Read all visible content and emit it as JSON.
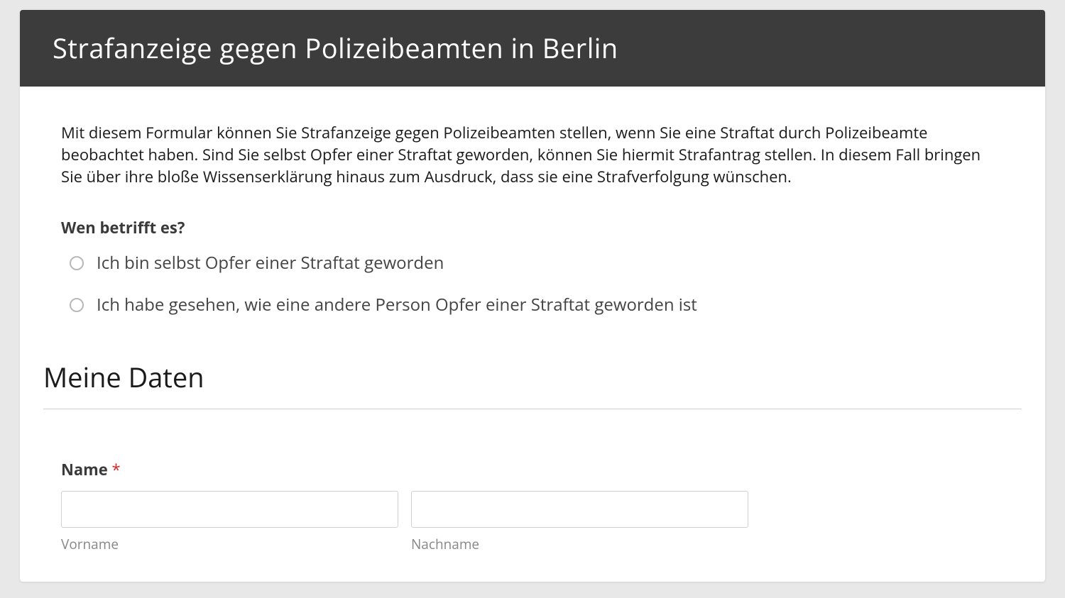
{
  "header": {
    "title": "Strafanzeige gegen Polizeibeamten in Berlin"
  },
  "intro": {
    "text": "Mit diesem Formular können Sie Strafanzeige gegen Polizeibeamten stellen, wenn Sie eine Straftat durch Polizeibeamte beobachtet haben. Sind Sie selbst Opfer einer Straftat geworden, können Sie hiermit Strafantrag stellen. In diesem Fall bringen Sie über ihre bloße Wissenserklärung hinaus zum Ausdruck, dass sie eine Strafverfolgung wünschen."
  },
  "question1": {
    "label": "Wen betrifft es?",
    "options": [
      "Ich bin selbst Opfer einer Straftat geworden",
      "Ich habe gesehen, wie eine andere Person Opfer einer Straftat geworden ist"
    ]
  },
  "section": {
    "heading": "Meine Daten"
  },
  "nameField": {
    "label": "Name",
    "required": "*",
    "firstNameSublabel": "Vorname",
    "lastNameSublabel": "Nachname",
    "firstNameValue": "",
    "lastNameValue": ""
  }
}
